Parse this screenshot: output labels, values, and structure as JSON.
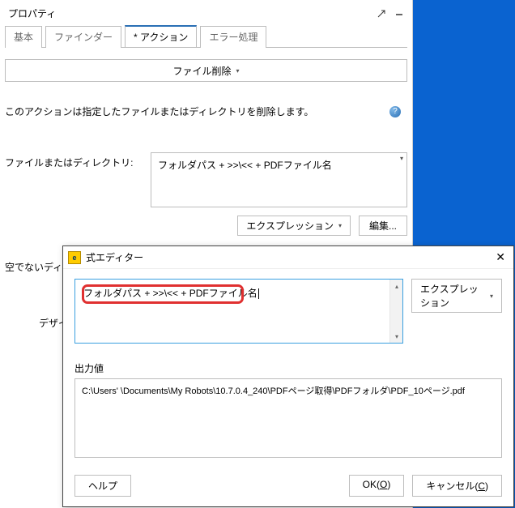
{
  "panel": {
    "title": "プロパティ",
    "tabs": [
      "基本",
      "ファインダー",
      "* アクション",
      "エラー処理"
    ],
    "activeTab": 2,
    "actionName": "ファイル削除",
    "description": "このアクションは指定したファイルまたはディレクトリを削除します。",
    "fileField": {
      "label": "ファイルまたはディレクトリ:",
      "value": "フォルダパス + >>\\<< + PDFファイル名"
    },
    "expressionBtn": "エクスプレッション",
    "editBtn": "編集...",
    "emptyDirLabel": "空でないディレクトリを削除:",
    "designLabel": "デザイ"
  },
  "dialog": {
    "title": "式エディター",
    "expression": "フォルダパス + >>\\<< + PDFファイル名",
    "expressionBtn": "エクスプレッション",
    "outputLabel": "出力値",
    "outputValue": "C:\\Users'        \\Documents\\My Robots\\10.7.0.4_240\\PDFページ取得\\PDFフォルダ\\PDF_10ページ.pdf",
    "helpBtn": "ヘルプ",
    "okBtn": "OK",
    "okMnemonic": "O",
    "cancelBtn": "キャンセル",
    "cancelMnemonic": "C"
  }
}
